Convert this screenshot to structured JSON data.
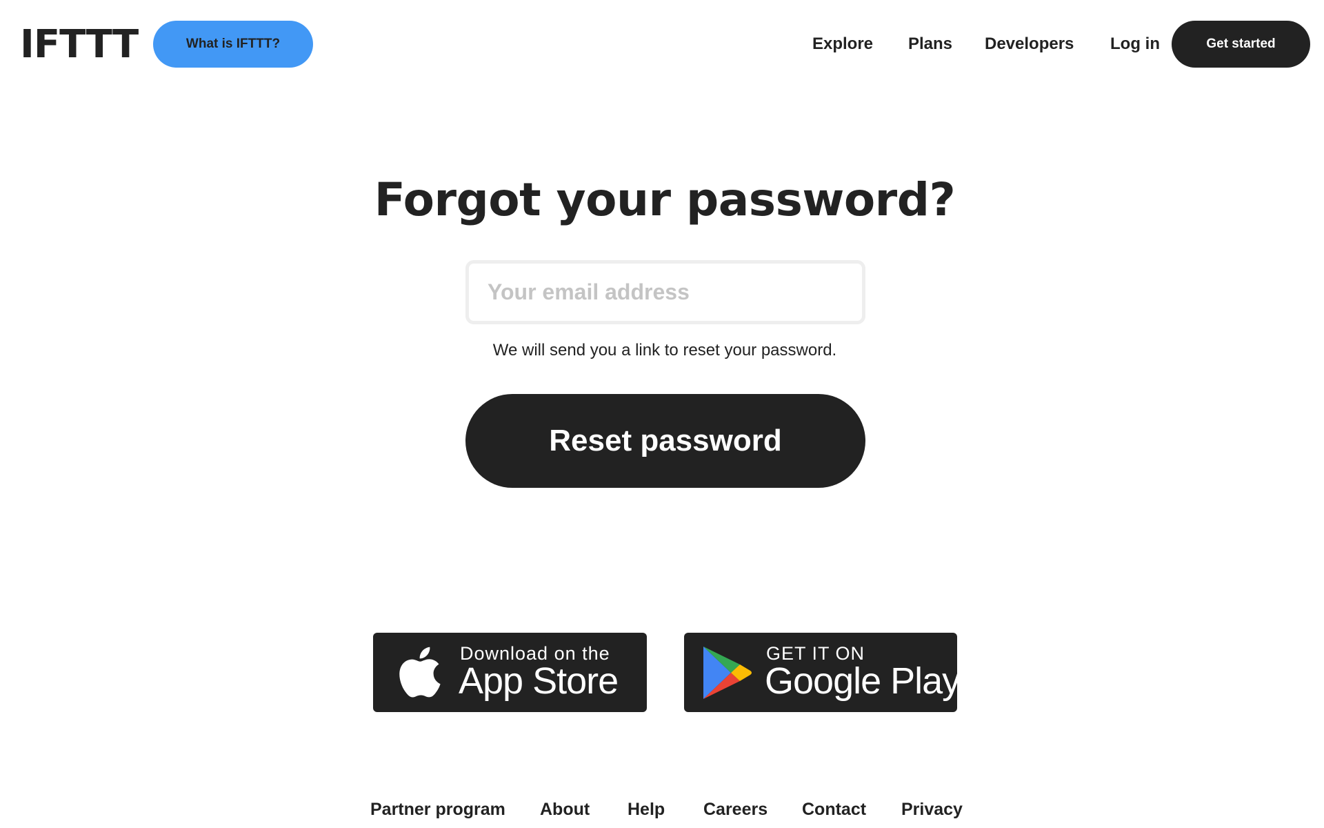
{
  "header": {
    "logo": "IFTTT",
    "what_is_label": "What is IFTTT?",
    "nav": {
      "explore": "Explore",
      "plans": "Plans",
      "developers": "Developers",
      "login": "Log in"
    },
    "get_started_label": "Get started"
  },
  "main": {
    "title": "Forgot your password?",
    "email_placeholder": "Your email address",
    "email_value": "",
    "helper_text": "We will send you a link to reset your password.",
    "reset_label": "Reset password"
  },
  "badges": {
    "app_store": {
      "small": "Download on the",
      "big": "App Store",
      "icon": "apple-icon"
    },
    "google_play": {
      "small": "GET IT ON",
      "big": "Google Play",
      "icon": "google-play-icon"
    }
  },
  "footer": {
    "partner": "Partner program",
    "about": "About",
    "help": "Help",
    "careers": "Careers",
    "contact": "Contact",
    "privacy": "Privacy"
  },
  "colors": {
    "accent_blue": "#4298f5",
    "dark": "#222222",
    "input_border": "#eeeeee",
    "placeholder": "#c4c4c4"
  }
}
